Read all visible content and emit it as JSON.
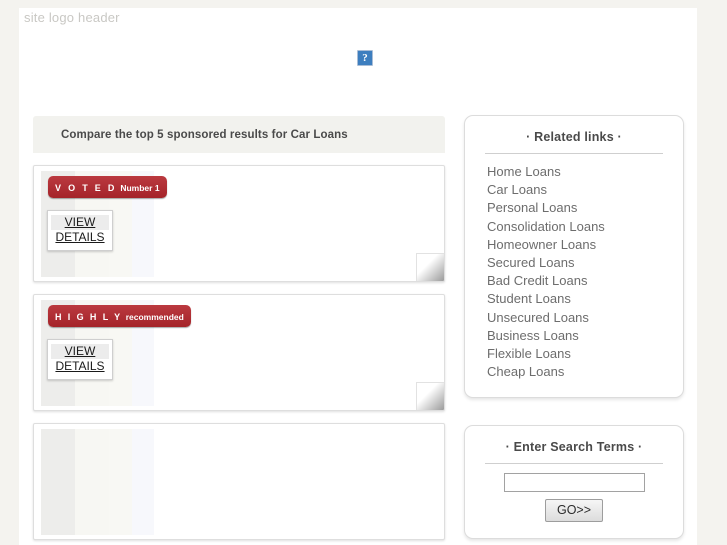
{
  "header": {
    "logo_text": "site logo header",
    "broken_image_icon": "broken-image-icon",
    "broken_image_glyph": "?"
  },
  "results": {
    "compare_title": "Compare the top 5 sponsored results for Car Loans",
    "cards": [
      {
        "badge_top": "V O T E D",
        "badge_bottom": "Number 1",
        "view_line1": "VIEW",
        "view_line2": "DETAILS"
      },
      {
        "badge_top": "H I G H L Y",
        "badge_bottom": "recommended",
        "view_line1": "VIEW",
        "view_line2": "DETAILS"
      },
      {
        "badge_top": "",
        "badge_bottom": "",
        "view_line1": "",
        "view_line2": ""
      }
    ]
  },
  "sidebar": {
    "related": {
      "title": "·  Related links  ·",
      "links": [
        "Home Loans",
        "Car Loans",
        "Personal Loans",
        "Consolidation Loans",
        "Homeowner Loans",
        "Secured Loans",
        "Bad Credit Loans",
        "Student Loans",
        "Unsecured Loans",
        "Business Loans",
        "Flexible Loans",
        "Cheap Loans"
      ]
    },
    "search": {
      "title": "·  Enter Search Terms  ·",
      "input_value": "",
      "input_placeholder": "",
      "go_label": "GO>>"
    }
  },
  "colors": {
    "page_background": "#f4f3ef",
    "content_background": "#ffffff",
    "badge_red": "#b02c32",
    "header_band": "#f2f2ee",
    "link_text": "#6d6d6d",
    "broken_image_blue": "#3d7ebf"
  }
}
